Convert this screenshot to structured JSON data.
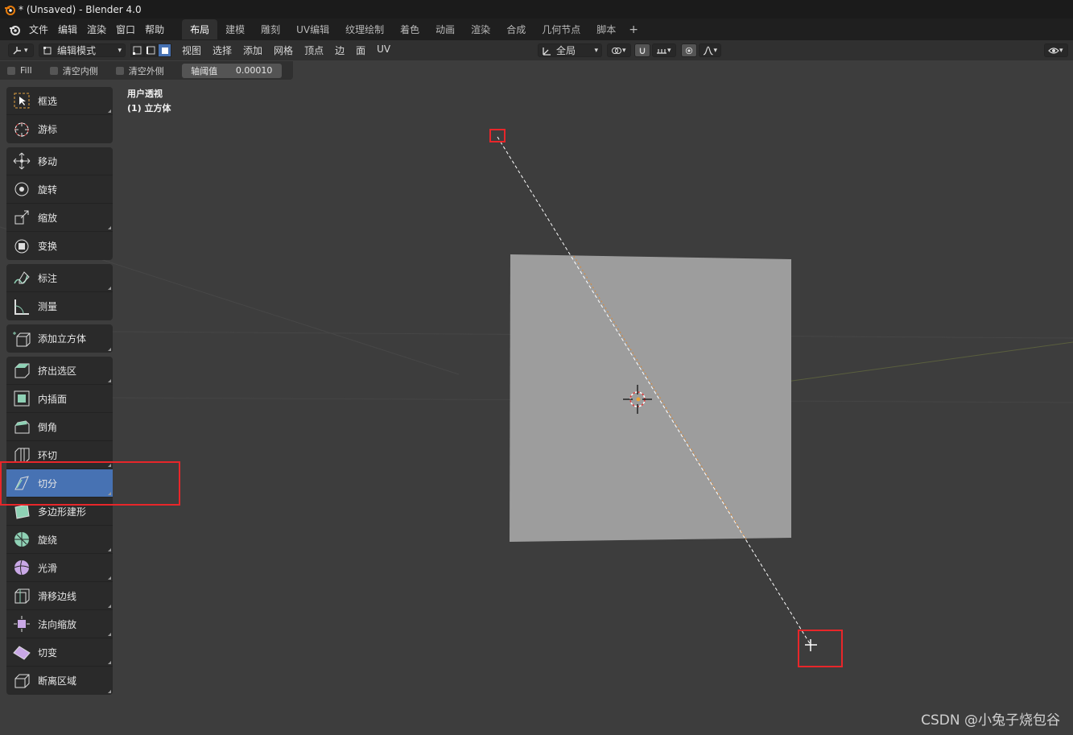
{
  "window": {
    "title": "* (Unsaved) - Blender 4.0",
    "icon": "blender-logo-icon"
  },
  "menubar": {
    "items": [
      "文件",
      "编辑",
      "渲染",
      "窗口",
      "帮助"
    ],
    "workspace_tabs": [
      "布局",
      "建模",
      "雕刻",
      "UV编辑",
      "纹理绘制",
      "着色",
      "动画",
      "渲染",
      "合成",
      "几何节点",
      "脚本"
    ],
    "active_tab": "布局",
    "add_tab": "+"
  },
  "header": {
    "mode": "编辑模式",
    "menus": [
      "视图",
      "选择",
      "添加",
      "网格",
      "顶点",
      "边",
      "面",
      "UV"
    ],
    "orientation": "全局"
  },
  "knife_options": {
    "fill_label": "Fill",
    "clear_inner_label": "清空内侧",
    "clear_outer_label": "清空外侧",
    "threshold_label": "轴阈值",
    "threshold_value": "0.00010"
  },
  "viewport": {
    "view_name": "用户透视",
    "object_name": "(1) 立方体"
  },
  "toolbar": {
    "groups": [
      [
        {
          "label": "框选",
          "icon": "box-select-icon"
        },
        {
          "label": "游标",
          "icon": "cursor-icon"
        }
      ],
      [
        {
          "label": "移动",
          "icon": "move-icon"
        },
        {
          "label": "旋转",
          "icon": "rotate-icon"
        },
        {
          "label": "缩放",
          "icon": "scale-icon"
        },
        {
          "label": "变换",
          "icon": "transform-icon"
        }
      ],
      [
        {
          "label": "标注",
          "icon": "annotate-icon"
        },
        {
          "label": "测量",
          "icon": "measure-icon"
        }
      ],
      [
        {
          "label": "添加立方体",
          "icon": "add-cube-icon"
        }
      ],
      [
        {
          "label": "挤出选区",
          "icon": "extrude-icon"
        },
        {
          "label": "内插面",
          "icon": "inset-icon"
        },
        {
          "label": "倒角",
          "icon": "bevel-icon"
        },
        {
          "label": "环切",
          "icon": "loop-cut-icon"
        },
        {
          "label": "切分",
          "icon": "knife-icon"
        },
        {
          "label": "多边形建形",
          "icon": "poly-build-icon"
        },
        {
          "label": "旋绕",
          "icon": "spin-icon"
        },
        {
          "label": "光滑",
          "icon": "smooth-icon"
        },
        {
          "label": "滑移边线",
          "icon": "edge-slide-icon"
        },
        {
          "label": "法向缩放",
          "icon": "shrink-fatten-icon"
        },
        {
          "label": "切变",
          "icon": "shear-icon"
        },
        {
          "label": "断离区域",
          "icon": "rip-region-icon"
        }
      ]
    ],
    "active_tool": "切分"
  },
  "colors": {
    "accent": "#4772b3",
    "highlight": "#e8262a",
    "mesh_face": "#9d9d9d",
    "viewport_bg": "#3d3d3d"
  },
  "watermark": "CSDN @小兔子烧包谷"
}
